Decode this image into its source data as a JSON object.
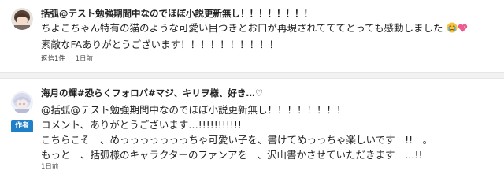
{
  "comments": [
    {
      "author": "括弧@テスト勉強期間中なのでほぼ小説更新無し！！！！！！！！",
      "lines": [
        "ちよこちゃん特有の猫のような可愛い目つきとお口が再現されてててとっても感動しました",
        "素敵なFAありがとうございます！！！！！！！！！！"
      ],
      "emojis": [
        "crying-face",
        "heart"
      ],
      "reply_label": "返信1件",
      "time": "1日前"
    },
    {
      "author": "海月の輝#恐らくフォロバ#マジ、キリヲ様、好き…♡",
      "badge": "作者",
      "lines": [
        "@括弧@テスト勉強期間中なのでほぼ小説更新無し！！！！！！！！",
        "コメント、ありがとうございます…!!!!!!!!!!!",
        "こちらこそ　、めっっっっっっっちゃ可愛い子を、書けてめっっちゃ楽しいです　!!　。",
        "もっと　、括弧様のキャラクターのファンアを　、沢山書かさせていただきます　…!!"
      ],
      "time": "1日前"
    }
  ],
  "colors": {
    "author_badge": "#1f7fc7",
    "separator": "#f2f2f2"
  }
}
